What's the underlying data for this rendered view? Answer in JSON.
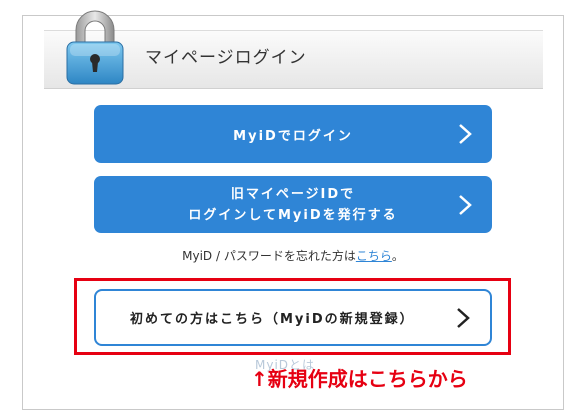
{
  "header": {
    "title": "マイページログイン",
    "icon": "lock-icon"
  },
  "buttons": {
    "myid_login": "MyiDでログイン",
    "old_login_line1": "旧マイページIDで",
    "old_login_line2": "ログインしてMyiDを発行する",
    "first_time": "初めての方はこちら（MyiDの新規登録）"
  },
  "forgot": {
    "text": "MyiD / パスワードを忘れた方は",
    "link": "こちら",
    "suffix": "。"
  },
  "partial_text": "MyiDとは",
  "annotation": {
    "arrow": "↑",
    "text": "新規作成はこちらから"
  },
  "colors": {
    "accent": "#2f85d6",
    "annotation": "#e60012"
  }
}
